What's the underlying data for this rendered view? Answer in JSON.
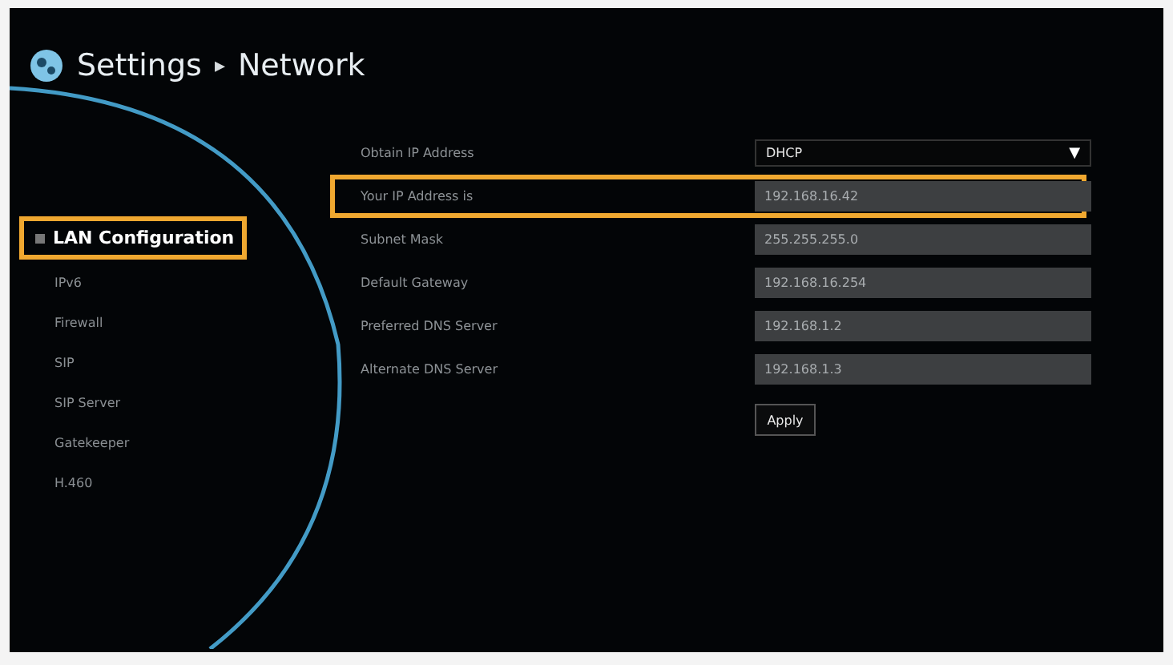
{
  "header": {
    "title": "Settings",
    "separator": "▸",
    "subtitle": "Network"
  },
  "sidebar": {
    "items": [
      {
        "label": "LAN Configuration",
        "selected": true
      },
      {
        "label": "IPv6",
        "selected": false
      },
      {
        "label": "Firewall",
        "selected": false
      },
      {
        "label": "SIP",
        "selected": false
      },
      {
        "label": "SIP Server",
        "selected": false
      },
      {
        "label": "Gatekeeper",
        "selected": false
      },
      {
        "label": "H.460",
        "selected": false
      }
    ]
  },
  "form": {
    "rows": [
      {
        "kind": "dropdown",
        "label": "Obtain IP Address",
        "value": "DHCP",
        "caret": "▼",
        "focused": false
      },
      {
        "kind": "field",
        "label": "Your IP Address is",
        "value": "192.168.16.42",
        "focused": true
      },
      {
        "kind": "field",
        "label": "Subnet Mask",
        "value": "255.255.255.0",
        "focused": false
      },
      {
        "kind": "field",
        "label": "Default Gateway",
        "value": "192.168.16.254",
        "focused": false
      },
      {
        "kind": "field",
        "label": "Preferred DNS Server",
        "value": "192.168.1.2",
        "focused": false
      },
      {
        "kind": "field",
        "label": "Alternate DNS Server",
        "value": "192.168.1.3",
        "focused": false
      }
    ],
    "apply": "Apply"
  }
}
